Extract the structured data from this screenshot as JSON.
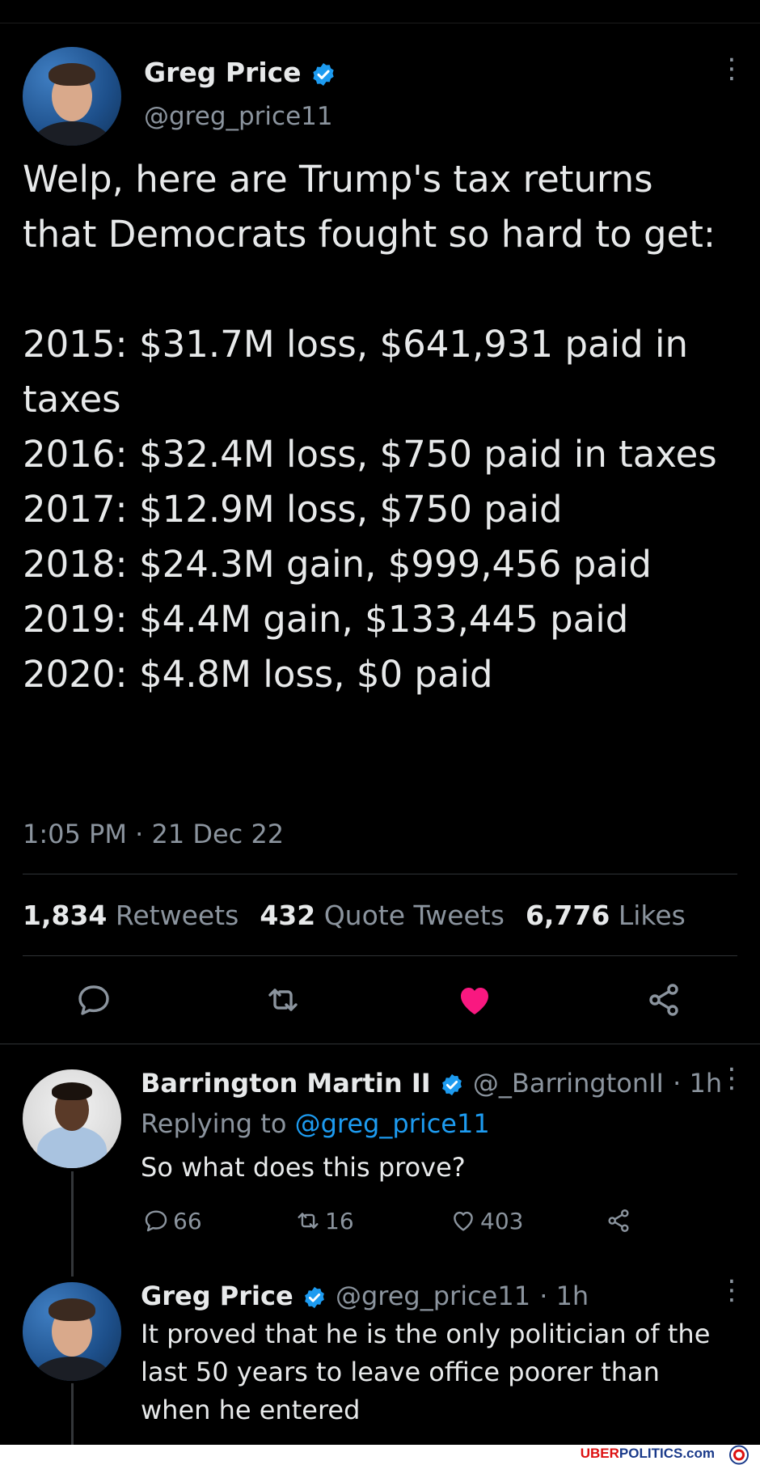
{
  "main_tweet": {
    "author_name": "Greg Price",
    "author_handle": "@greg_price11",
    "text": "Welp, here are Trump's tax returns that Democrats fought so hard to get:\n\n2015: $31.7M loss, $641,931 paid in taxes\n2016: $32.4M loss, $750 paid in taxes\n2017: $12.9M loss, $750 paid\n2018: $24.3M gain, $999,456 paid\n2019: $4.4M gain, $133,445 paid\n2020: $4.8M loss, $0 paid",
    "timestamp": "1:05 PM · 21 Dec 22",
    "stats": {
      "retweets_count": "1,834",
      "retweets_label": "Retweets",
      "quotes_count": "432",
      "quotes_label": "Quote Tweets",
      "likes_count": "6,776",
      "likes_label": "Likes"
    }
  },
  "replies": [
    {
      "author_name": "Barrington Martin II",
      "author_handle": "@_BarringtonII",
      "time": "· 1h",
      "replying_prefix": "Replying to",
      "replying_to": "@greg_price11",
      "text": "So what does this prove?",
      "replies_count": "66",
      "retweets_count": "16",
      "likes_count": "403"
    },
    {
      "author_name": "Greg Price",
      "author_handle": "@greg_price11",
      "time": "· 1h",
      "text": "It proved that he is the only politician of the last 50 years to leave office poorer than when he entered"
    }
  ],
  "footer": {
    "brand_red": "UBER",
    "brand_blue": "POLITICS.com"
  },
  "colors": {
    "background": "#000000",
    "text": "#e7e9ea",
    "secondary": "#8b949e",
    "link": "#1d9bf0",
    "like_active": "#f91880",
    "verified": "#1d9bf0"
  },
  "icons": [
    "verified-badge-icon",
    "more-options-icon",
    "reply-icon",
    "retweet-icon",
    "heart-icon",
    "share-icon"
  ]
}
